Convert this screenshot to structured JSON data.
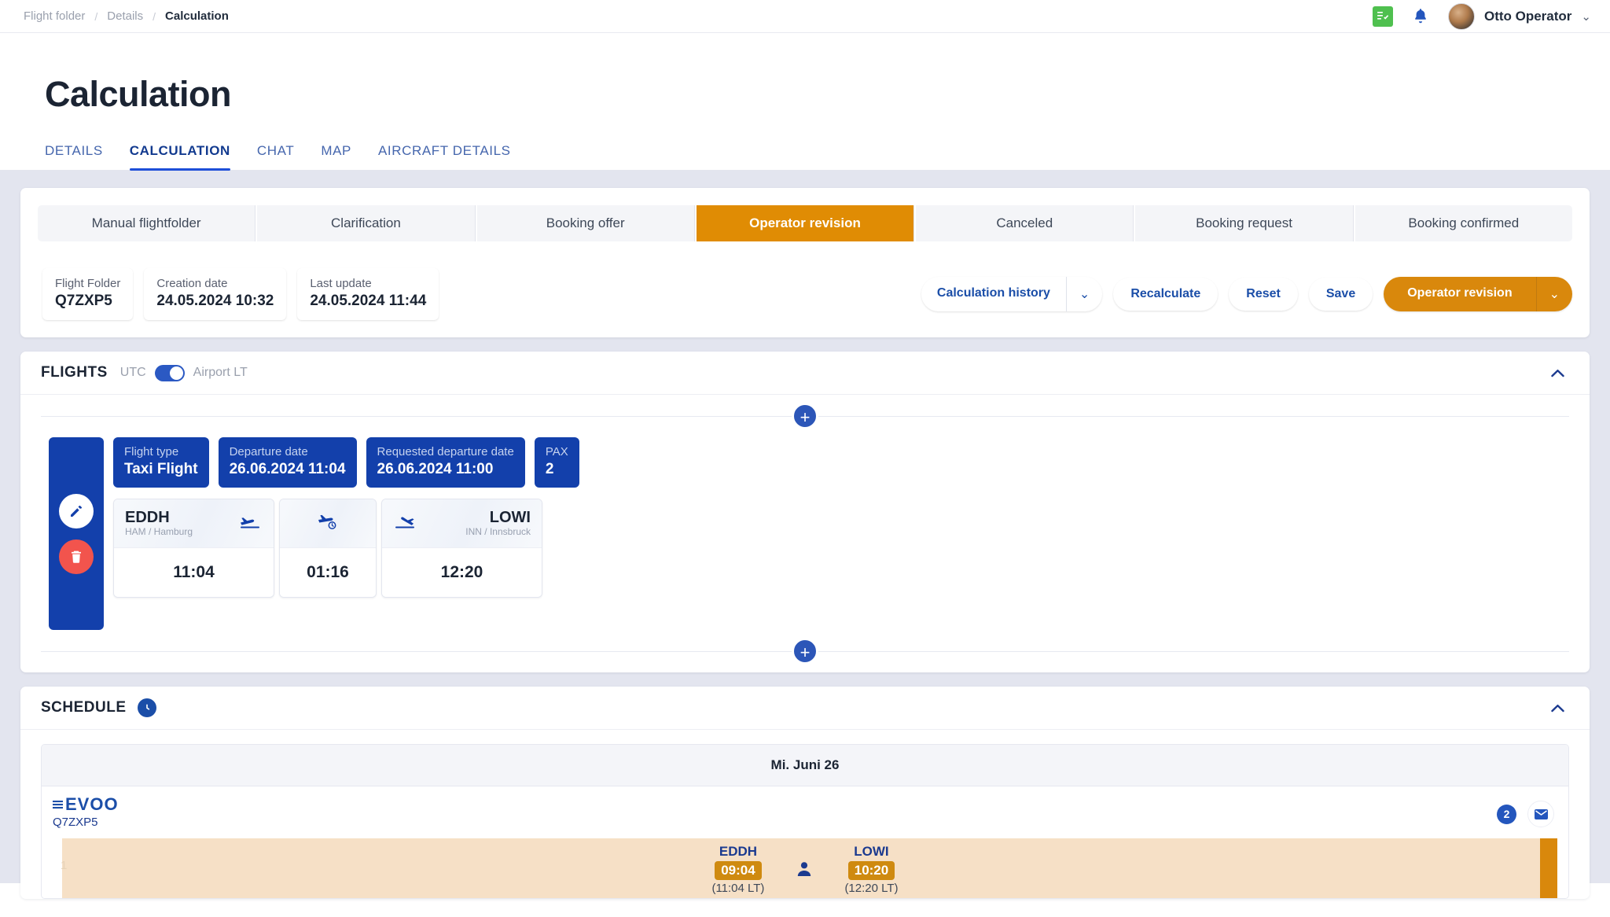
{
  "breadcrumb": {
    "items": [
      "Flight folder",
      "Details",
      "Calculation"
    ],
    "separator": "/"
  },
  "header": {
    "user_name": "Otto Operator",
    "checklist_icon": "checklist-icon",
    "bell_icon": "bell-icon",
    "chevron": "⌄"
  },
  "page": {
    "title": "Calculation"
  },
  "tabs": [
    {
      "label": "DETAILS",
      "active": false
    },
    {
      "label": "CALCULATION",
      "active": true
    },
    {
      "label": "CHAT",
      "active": false
    },
    {
      "label": "MAP",
      "active": false
    },
    {
      "label": "AIRCRAFT DETAILS",
      "active": false
    }
  ],
  "stepper": {
    "active_color": "#e08c04",
    "steps": [
      {
        "label": "Manual flightfolder",
        "active": false
      },
      {
        "label": "Clarification",
        "active": false
      },
      {
        "label": "Booking offer",
        "active": false
      },
      {
        "label": "Operator revision",
        "active": true
      },
      {
        "label": "Canceled",
        "active": false
      },
      {
        "label": "Booking request",
        "active": false
      },
      {
        "label": "Booking confirmed",
        "active": false
      }
    ]
  },
  "info_bar": {
    "chips": [
      {
        "key": "Flight Folder",
        "value": "Q7ZXP5"
      },
      {
        "key": "Creation date",
        "value": "24.05.2024 10:32"
      },
      {
        "key": "Last update",
        "value": "24.05.2024 11:44"
      }
    ],
    "calculation_history": "Calculation history",
    "recalculate": "Recalculate",
    "reset": "Reset",
    "save": "Save",
    "operator_revision": "Operator revision",
    "dropdown_caret": "⌄"
  },
  "flights": {
    "title": "FLIGHTS",
    "toggle_left_label": "UTC",
    "toggle_right_label": "Airport LT",
    "toggle_on": true,
    "collapse_icon": "chevron-up-icon",
    "add_label": "+",
    "chips": [
      {
        "key": "Flight type",
        "value": "Taxi Flight"
      },
      {
        "key": "Departure date",
        "value": "26.06.2024 11:04"
      },
      {
        "key": "Requested departure date",
        "value": "26.06.2024 11:00"
      },
      {
        "key": "PAX",
        "value": "2"
      }
    ],
    "legs": {
      "origin": {
        "code": "EDDH",
        "sub": "HAM / Hamburg",
        "time": "11:04"
      },
      "duration": {
        "time": "01:16"
      },
      "destination": {
        "code": "LOWI",
        "sub": "INN / Innsbruck",
        "time": "12:20"
      }
    }
  },
  "schedule": {
    "title": "SCHEDULE",
    "clock_icon": "clock-icon",
    "collapse_icon": "chevron-up-icon",
    "date_header": "Mi. Juni 26",
    "operator_logo": "EVOO",
    "flight_folder": "Q7ZXP5",
    "badge_count": "2",
    "mail_icon": "mail-icon",
    "row_number": "1",
    "stops": [
      {
        "code": "EDDH",
        "time": "09:04",
        "local": "(11:04 LT)"
      },
      {
        "code": "LOWI",
        "time": "10:20",
        "local": "(12:20 LT)"
      }
    ]
  }
}
